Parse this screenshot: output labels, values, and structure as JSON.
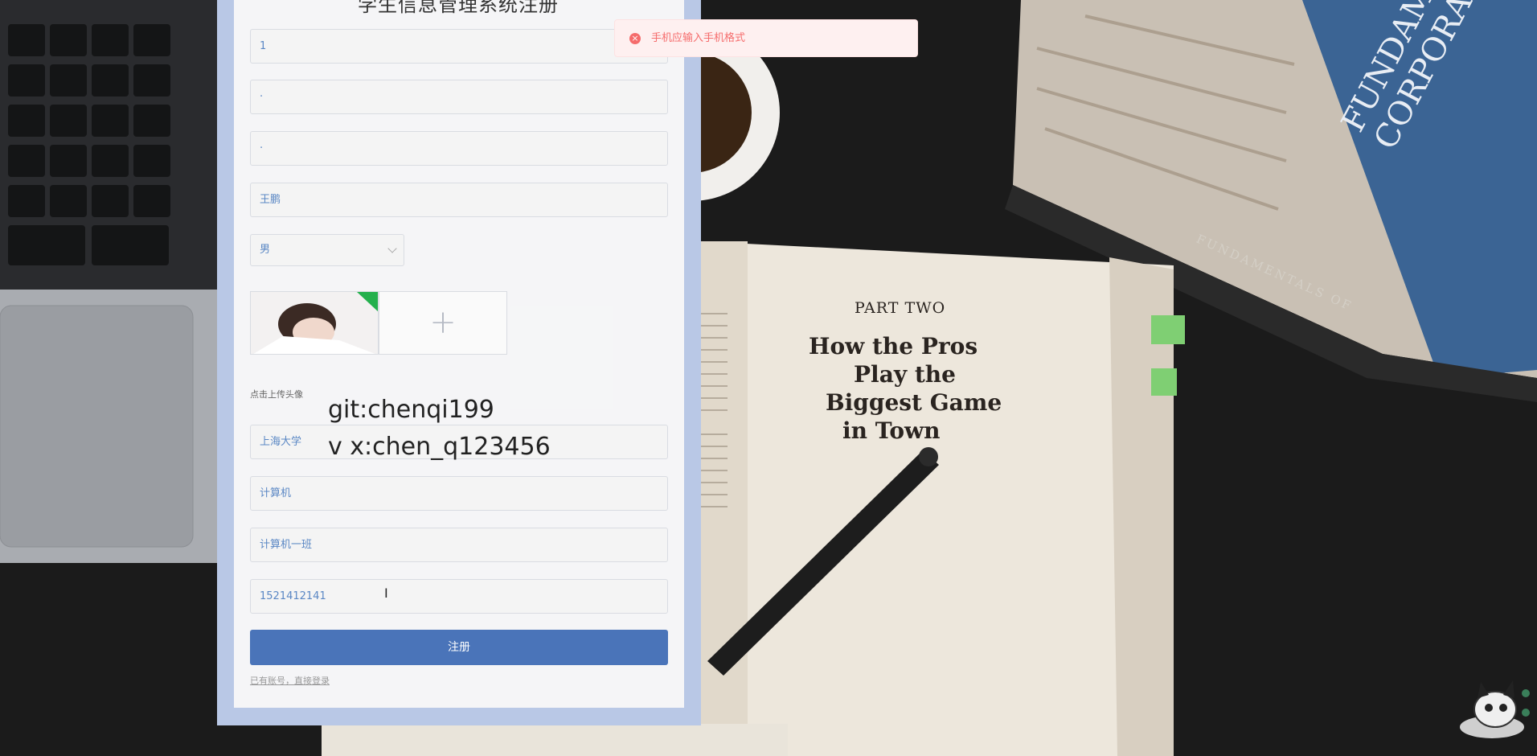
{
  "page": {
    "title": "学生信息管理系统注册"
  },
  "form": {
    "fields": [
      {
        "name": "username",
        "value": "1"
      },
      {
        "name": "password",
        "value": "·"
      },
      {
        "name": "confirm-password",
        "value": "·"
      },
      {
        "name": "real-name",
        "value": "王鹏"
      },
      {
        "name": "school",
        "value": "上海大学"
      },
      {
        "name": "major",
        "value": "计算机"
      },
      {
        "name": "class",
        "value": "计算机一班"
      },
      {
        "name": "phone",
        "value": "1521412141"
      }
    ],
    "gender": "男",
    "avatar_hint": "点击上传头像",
    "register_label": "注册",
    "login_link": "已有账号，直接登录"
  },
  "overlay": {
    "line1": "git:chenqi199",
    "line2": "v x:chen_q123456"
  },
  "toast": {
    "message": "手机应输入手机格式",
    "type_color": "#f56c6c"
  },
  "background": {
    "book_heading": "PART TWO",
    "book_title_lines": [
      "How the Pros",
      "Play the",
      "Biggest Game",
      "in Town"
    ],
    "book_cover_text": "FUNDAMENTALS CORPORATE",
    "book_spine_text": "FUNDAMENTALS OF"
  },
  "colors": {
    "accent": "#4a74b9",
    "panel_border": "#b9c8e6",
    "input_text": "#5a87c4"
  }
}
